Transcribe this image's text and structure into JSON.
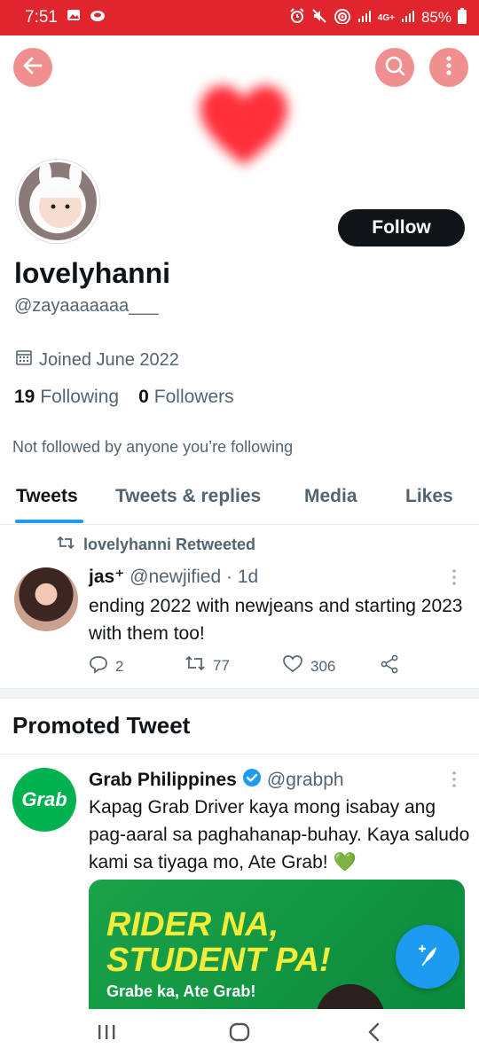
{
  "status_bar": {
    "time": "7:51",
    "battery": "85%",
    "network": "4G+",
    "bg_color": "#e0252c"
  },
  "profile": {
    "display_name": "lovelyhanni",
    "handle": "@zayaaaaaaa___",
    "joined": "Joined June 2022",
    "following_count": "19",
    "following_label": "Following",
    "followers_count": "0",
    "followers_label": "Followers",
    "not_followed_note": "Not followed by anyone you’re following",
    "follow_button": "Follow"
  },
  "tabs": [
    {
      "label": "Tweets",
      "active": true
    },
    {
      "label": "Tweets & replies",
      "active": false
    },
    {
      "label": "Media",
      "active": false
    },
    {
      "label": "Likes",
      "active": false
    }
  ],
  "retweet": {
    "context": "lovelyhanni Retweeted",
    "author_name": "jas⁺",
    "author_handle": "@newjified",
    "age": "· 1d",
    "text": "ending 2022 with newjeans and starting 2023 with them too!",
    "replies": "2",
    "retweets": "77",
    "likes": "306"
  },
  "promoted": {
    "section_title": "Promoted Tweet",
    "logo_text": "Grab",
    "author_name": "Grab Philippines",
    "author_handle": "@grabph",
    "text": "Kapag Grab Driver kaya mong isabay ang pag-aaral sa paghahanap-buhay. Kaya saludo kami sa tiyaga mo, Ate Grab! 💚",
    "ad_line1": "RIDER NA,",
    "ad_line2": "STUDENT PA!",
    "ad_line3": "Grabe ka, Ate Grab!",
    "brand_color": "#00b14f"
  },
  "colors": {
    "accent": "#1d9bf0",
    "header_button": "#ef8f8f"
  }
}
